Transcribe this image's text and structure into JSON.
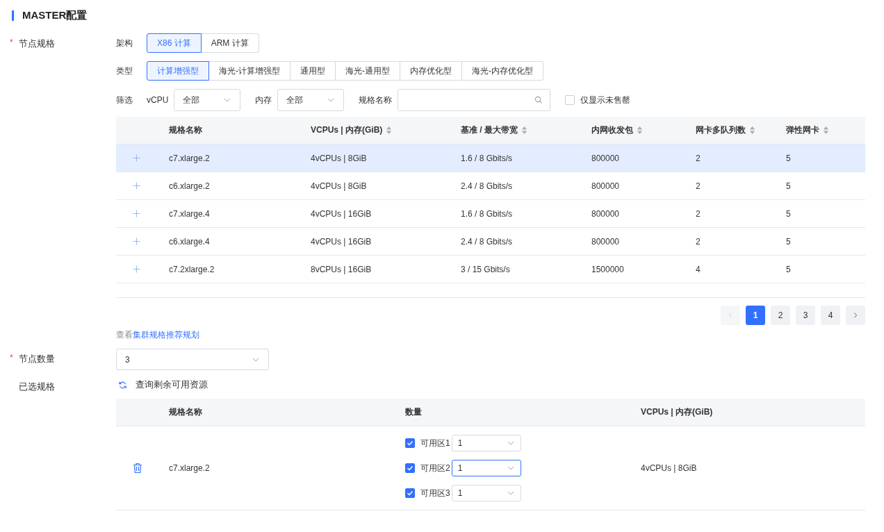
{
  "section_title": "MASTER配置",
  "spec": {
    "label": "节点规格",
    "required_mark": "*",
    "arch": {
      "label": "架构",
      "options": [
        {
          "label": "X86 计算",
          "selected": true
        },
        {
          "label": "ARM 计算",
          "selected": false
        }
      ]
    },
    "type": {
      "label": "类型",
      "options": [
        {
          "label": "计算增强型",
          "selected": true
        },
        {
          "label": "海光-计算增强型",
          "selected": false
        },
        {
          "label": "通用型",
          "selected": false
        },
        {
          "label": "海光-通用型",
          "selected": false
        },
        {
          "label": "内存优化型",
          "selected": false
        },
        {
          "label": "海光-内存优化型",
          "selected": false
        }
      ]
    },
    "filter": {
      "label": "筛选",
      "vcpu_label": "vCPU",
      "vcpu_value": "全部",
      "mem_label": "内存",
      "mem_value": "全部",
      "name_label": "规格名称",
      "only_available": {
        "label": "仅显示未售罄",
        "checked": false
      }
    },
    "table": {
      "columns": [
        {
          "label": "规格名称",
          "sortable": false
        },
        {
          "label": "VCPUs | 内存(GiB)",
          "sortable": true
        },
        {
          "label": "基准 / 最大带宽",
          "sortable": true
        },
        {
          "label": "内网收发包",
          "sortable": true
        },
        {
          "label": "网卡多队列数",
          "sortable": true
        },
        {
          "label": "弹性网卡",
          "sortable": true
        }
      ],
      "rows": [
        {
          "selected": true,
          "cells": [
            "c7.xlarge.2",
            "4vCPUs | 8GiB",
            "1.6 / 8 Gbits/s",
            "800000",
            "2",
            "5"
          ]
        },
        {
          "selected": false,
          "cells": [
            "c6.xlarge.2",
            "4vCPUs | 8GiB",
            "2.4 / 8 Gbits/s",
            "800000",
            "2",
            "5"
          ]
        },
        {
          "selected": false,
          "cells": [
            "c7.xlarge.4",
            "4vCPUs | 16GiB",
            "1.6 / 8 Gbits/s",
            "800000",
            "2",
            "5"
          ]
        },
        {
          "selected": false,
          "cells": [
            "c6.xlarge.4",
            "4vCPUs | 16GiB",
            "2.4 / 8 Gbits/s",
            "800000",
            "2",
            "5"
          ]
        },
        {
          "selected": false,
          "cells": [
            "c7.2xlarge.2",
            "8vCPUs | 16GiB",
            "3 / 15 Gbits/s",
            "1500000",
            "4",
            "5"
          ]
        }
      ]
    },
    "pagination": {
      "prev_disabled": true,
      "pages": [
        {
          "label": "1",
          "selected": true
        },
        {
          "label": "2",
          "selected": false
        },
        {
          "label": "3",
          "selected": false
        },
        {
          "label": "4",
          "selected": false
        }
      ]
    },
    "hint": {
      "prefix": "查看",
      "link": "集群规格推荐规划"
    }
  },
  "count": {
    "label": "节点数量",
    "required_mark": "*",
    "value": "3"
  },
  "chosen": {
    "label": "已选规格",
    "query": "查询剩余可用资源",
    "columns": [
      "规格名称",
      "数量",
      "VCPUs | 内存(GiB)"
    ],
    "rows": [
      {
        "name": "c7.xlarge.2",
        "spec": "4vCPUs | 8GiB",
        "zones": [
          {
            "label": "可用区1",
            "checked": true,
            "value": "1",
            "focused": false
          },
          {
            "label": "可用区2",
            "checked": true,
            "value": "1",
            "focused": true
          },
          {
            "label": "可用区3",
            "checked": true,
            "value": "1",
            "focused": false
          }
        ]
      }
    ]
  }
}
